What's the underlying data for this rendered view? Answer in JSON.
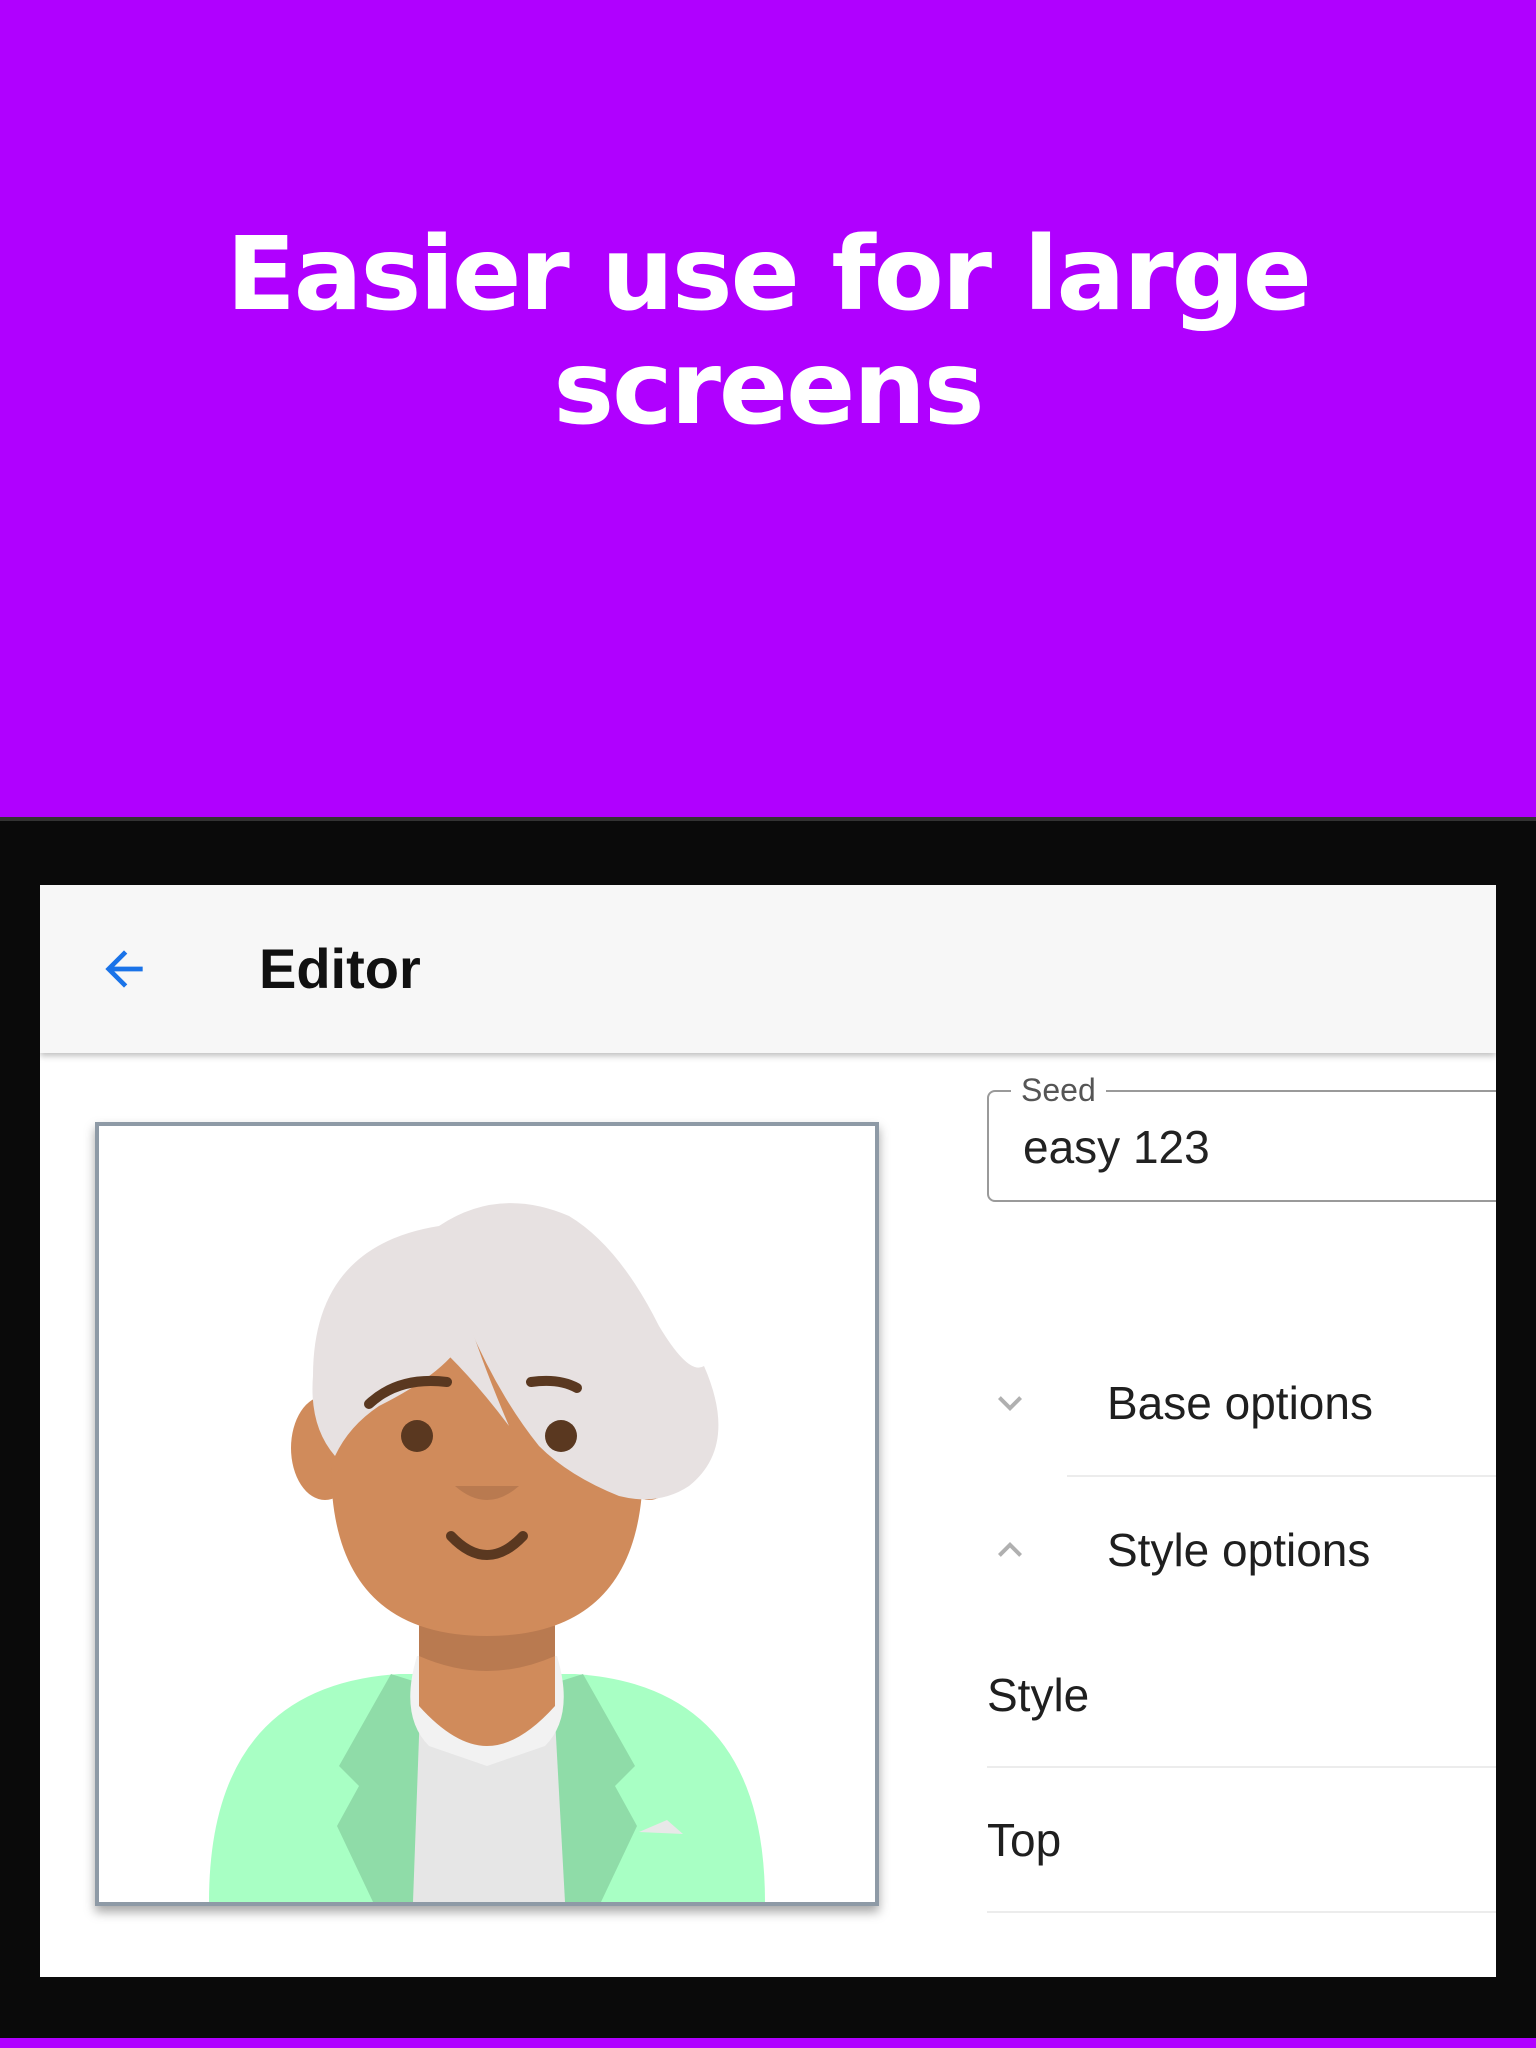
{
  "promo": {
    "title_line1": "Easier use for large",
    "title_line2": "screens"
  },
  "appbar": {
    "back_icon": "arrow-left-icon",
    "title": "Editor"
  },
  "seed": {
    "label": "Seed",
    "value": "easy 123"
  },
  "accordion": [
    {
      "label": "Base options",
      "icon": "chevron-down-icon",
      "expanded": false
    },
    {
      "label": "Style options",
      "icon": "chevron-up-icon",
      "expanded": true
    }
  ],
  "style_options": [
    {
      "label": "Style"
    },
    {
      "label": "Top"
    }
  ],
  "colors": {
    "promo_background": "#b000ff",
    "accent": "#1a73e8",
    "device_frame": "#0a0a0a",
    "appbar_background": "#f7f7f7",
    "avatar_hair": "#e7e1e1",
    "avatar_skin": "#d08b5b",
    "avatar_jacket": "#a8ffc4",
    "avatar_shirt": "#e6e6e6"
  }
}
